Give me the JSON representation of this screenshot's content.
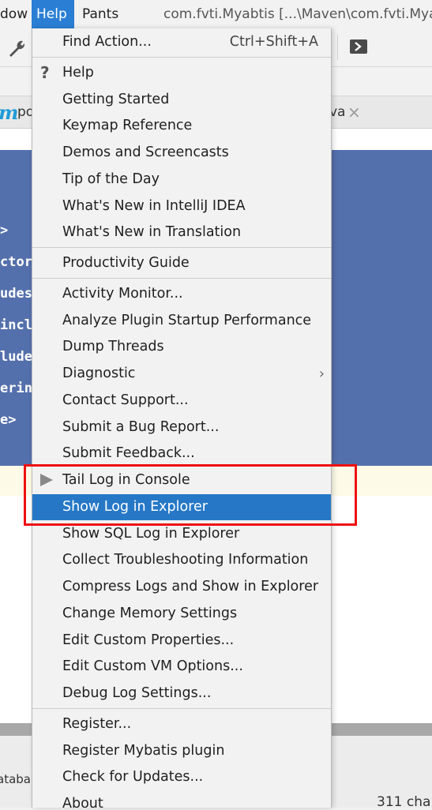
{
  "menubar": {
    "window_label": "dow",
    "help_label": "Help",
    "pants_label": "Pants",
    "title": "com.fvti.Myabtis [...\\Maven\\com.fvti.Mya"
  },
  "tabs": {
    "tab_a": "po",
    "tab_b": "va",
    "close": "×"
  },
  "editor": {
    "lines": [
      ">",
      "ctor",
      "udes",
      "incl",
      "lude",
      "erin",
      "e>"
    ]
  },
  "status": {
    "left_text": "ataba",
    "right_text": "311 cha"
  },
  "help_menu": {
    "items": [
      {
        "label": "Find Action...",
        "shortcut": "Ctrl+Shift+A"
      },
      {
        "label": "Help"
      },
      {
        "label": "Getting Started"
      },
      {
        "label": "Keymap Reference"
      },
      {
        "label": "Demos and Screencasts"
      },
      {
        "label": "Tip of the Day"
      },
      {
        "label": "What's New in IntelliJ IDEA"
      },
      {
        "label": "What's New in Translation"
      },
      {
        "label": "Productivity Guide"
      },
      {
        "label": "Activity Monitor..."
      },
      {
        "label": "Analyze Plugin Startup Performance"
      },
      {
        "label": "Dump Threads"
      },
      {
        "label": "Diagnostic",
        "arrow": "›"
      },
      {
        "label": "Contact Support..."
      },
      {
        "label": "Submit a Bug Report..."
      },
      {
        "label": "Submit Feedback..."
      },
      {
        "label": "Tail Log in Console"
      },
      {
        "label": "Show Log in Explorer",
        "selected": true
      },
      {
        "label": "Show SQL Log in Explorer"
      },
      {
        "label": "Collect Troubleshooting Information"
      },
      {
        "label": "Compress Logs and Show in Explorer"
      },
      {
        "label": "Change Memory Settings"
      },
      {
        "label": "Edit Custom Properties..."
      },
      {
        "label": "Edit Custom VM Options..."
      },
      {
        "label": "Debug Log Settings..."
      },
      {
        "label": "Register..."
      },
      {
        "label": "Register Mybatis plugin"
      },
      {
        "label": "Check for Updates..."
      },
      {
        "label": "About"
      }
    ]
  },
  "colors": {
    "selection": "#2678c6",
    "help_menu_active": "#2a7fd4",
    "editor_blue": "#5470ac",
    "highlight_border": "#ee1111"
  }
}
